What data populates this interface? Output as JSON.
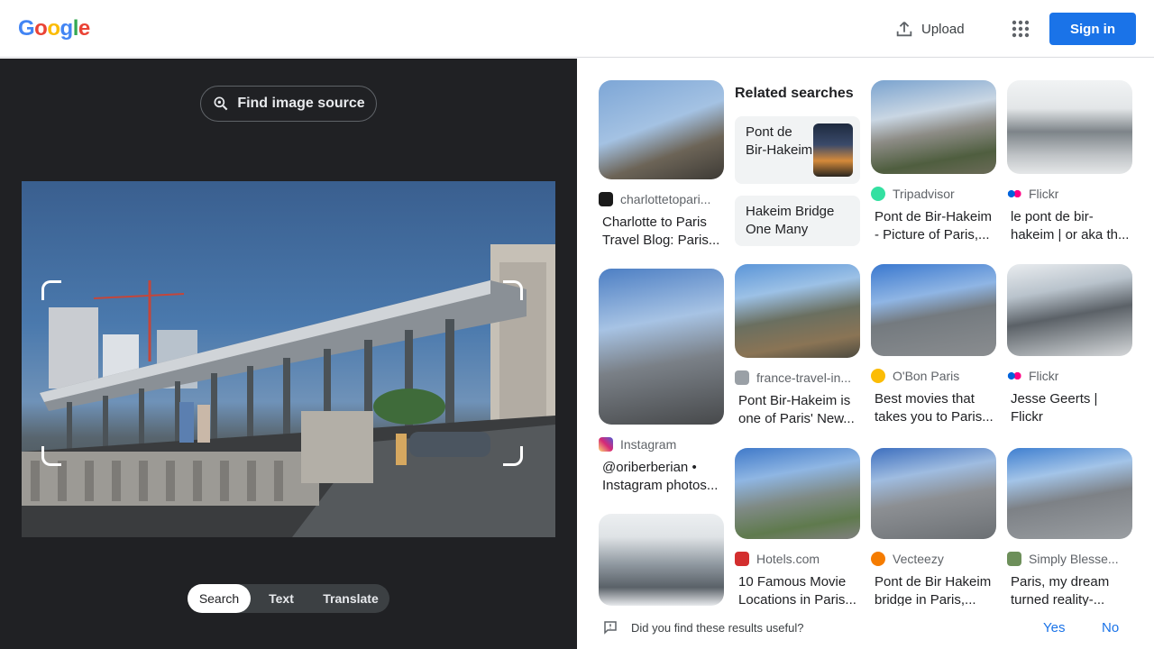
{
  "header": {
    "logo_letters": [
      "G",
      "o",
      "o",
      "g",
      "l",
      "e"
    ],
    "logo_colors": [
      "#4285f4",
      "#ea4335",
      "#fbbc05",
      "#4285f4",
      "#34a853",
      "#ea4335"
    ],
    "upload_label": "Upload",
    "signin_label": "Sign in"
  },
  "left": {
    "find_source_label": "Find image source",
    "modes": [
      {
        "label": "Search",
        "active": true
      },
      {
        "label": "Text",
        "active": false
      },
      {
        "label": "Translate",
        "active": false
      }
    ]
  },
  "related": {
    "title": "Related searches",
    "items": [
      "Pont de Bir-Hakeim",
      "Hakeim Bridge One Many"
    ]
  },
  "results": [
    {
      "source": "charlottetopari...",
      "title": "Charlotte to Paris Travel Blog: Paris...",
      "fav_color": "#1a1a1a"
    },
    {
      "source": "Tripadvisor",
      "title": "Pont de Bir-Hakeim - Picture of Paris,...",
      "fav_color": "#34e0a1"
    },
    {
      "source": "Flickr",
      "title": "le pont de bir-hakeim | or aka th...",
      "fav_color": "#ff0084"
    },
    {
      "source": "Instagram",
      "title": "@oriberberian • Instagram photos...",
      "fav_color": "#e1306c"
    },
    {
      "source": "france-travel-in...",
      "title": "Pont Bir-Hakeim is one of Paris' New...",
      "fav_color": "#9aa0a6"
    },
    {
      "source": "O'Bon Paris",
      "title": "Best movies that takes you to Paris...",
      "fav_color": "#fbbc05"
    },
    {
      "source": "Flickr",
      "title": "Jesse Geerts | Flickr",
      "fav_color": "#ff0084"
    },
    {
      "source": "Hotels.com",
      "title": "10 Famous Movie Locations in Paris...",
      "fav_color": "#d32f2f"
    },
    {
      "source": "Vecteezy",
      "title": "Pont de Bir Hakeim bridge in Paris,...",
      "fav_color": "#f57c00"
    },
    {
      "source": "Simply Blesse...",
      "title": "Paris, my dream turned reality-...",
      "fav_color": "#6d8f5a"
    }
  ],
  "feedback": {
    "question": "Did you find these results useful?",
    "yes": "Yes",
    "no": "No"
  }
}
